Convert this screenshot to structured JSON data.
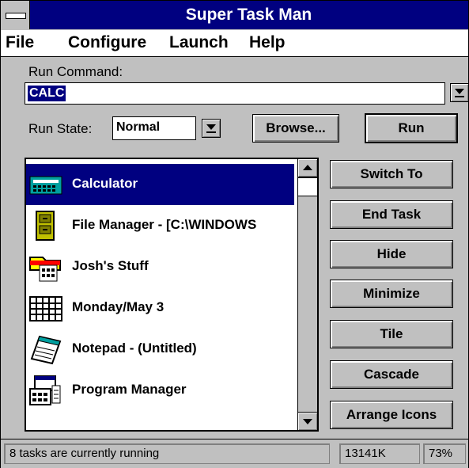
{
  "window": {
    "title": "Super Task Man"
  },
  "menu": [
    "File",
    "Configure",
    "Launch",
    "Help"
  ],
  "run_command": {
    "label": "Run Command:",
    "value": "CALC"
  },
  "run_state": {
    "label": "Run State:",
    "value": "Normal"
  },
  "buttons": {
    "browse": "Browse...",
    "run": "Run"
  },
  "tasks": [
    {
      "label": "Calculator",
      "icon": "calculator-icon",
      "selected": true
    },
    {
      "label": "File Manager - [C:\\WINDOWS",
      "icon": "file-cabinet-icon",
      "selected": false
    },
    {
      "label": "Josh's Stuff",
      "icon": "program-group-icon",
      "selected": false
    },
    {
      "label": "Monday/May 3",
      "icon": "calendar-icon",
      "selected": false
    },
    {
      "label": "Notepad - (Untitled)",
      "icon": "notepad-icon",
      "selected": false
    },
    {
      "label": "Program Manager",
      "icon": "program-manager-icon",
      "selected": false
    }
  ],
  "actions": [
    "Switch To",
    "End Task",
    "Hide",
    "Minimize",
    "Tile",
    "Cascade",
    "Arrange Icons"
  ],
  "status": {
    "message": "8 tasks are currently running",
    "memory": "13141K",
    "resources": "73%"
  },
  "colors": {
    "titlebar": "#000080",
    "selection": "#000080",
    "face": "#c0c0c0"
  }
}
